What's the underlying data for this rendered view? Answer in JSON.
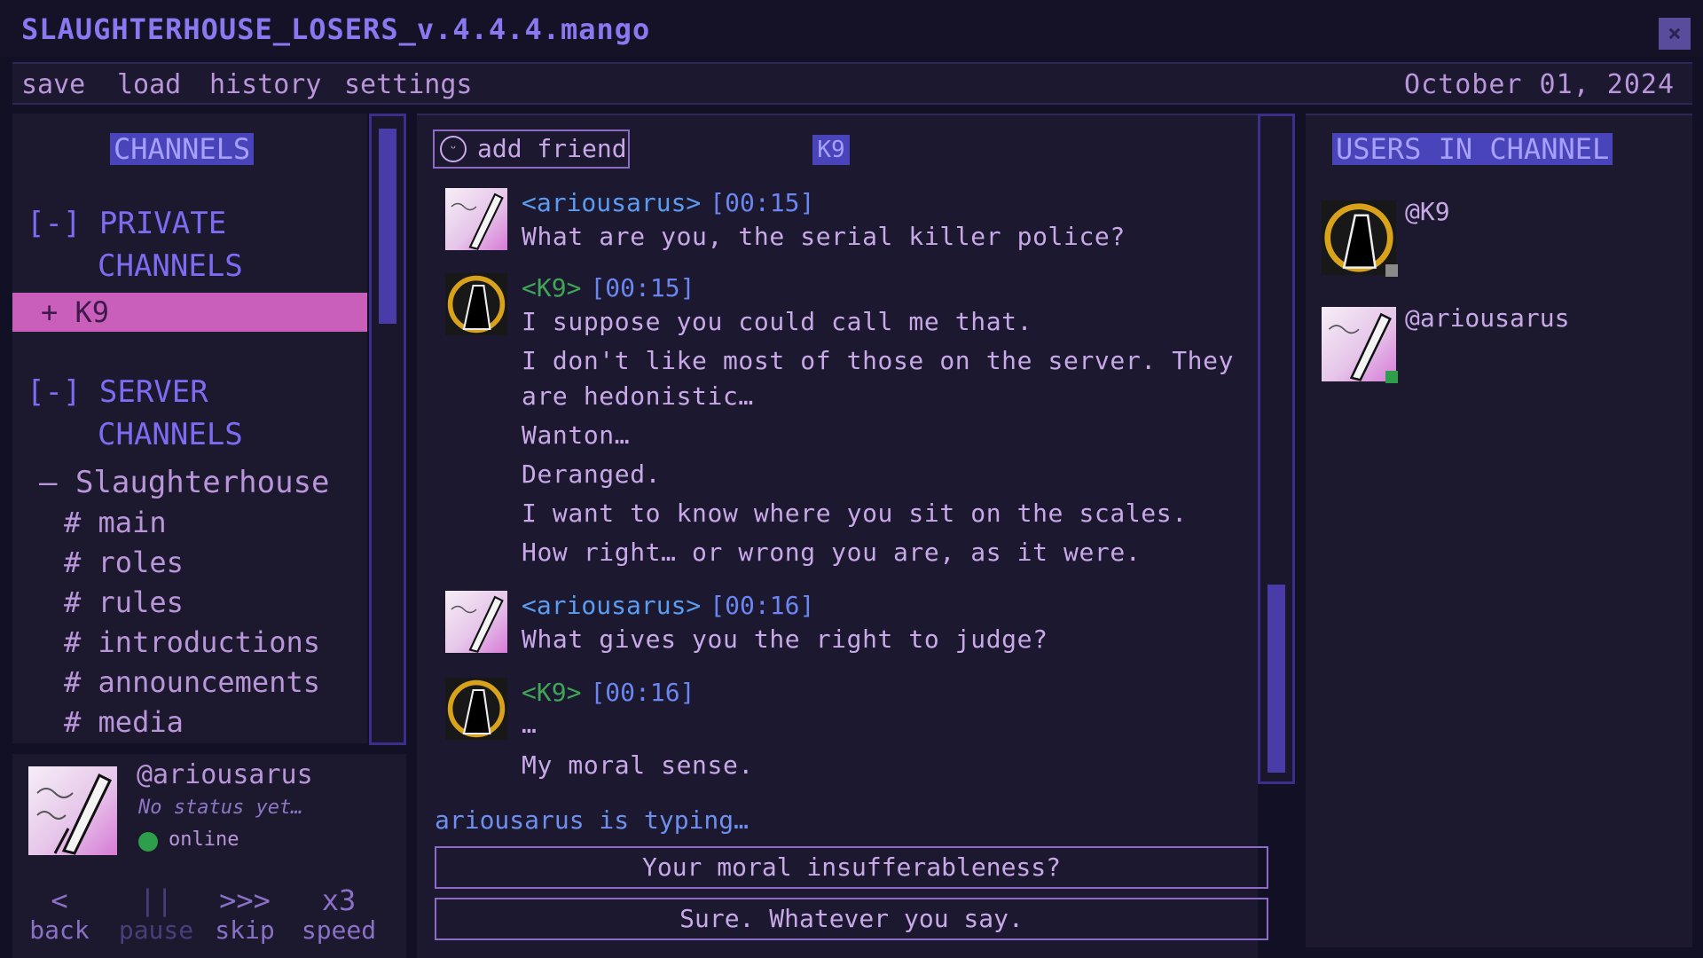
{
  "window": {
    "title": "SLAUGHTERHOUSE_LOSERS_v.4.4.4.mango",
    "close_glyph": "×"
  },
  "menu": {
    "items": [
      "save",
      "load",
      "history",
      "settings"
    ],
    "date": "October 01, 2024"
  },
  "sidebar": {
    "heading": "CHANNELS",
    "private_group": {
      "line1": "[-] PRIVATE",
      "line2": "CHANNELS"
    },
    "selected_channel": "+ K9",
    "server_group": {
      "line1": "[-] SERVER",
      "line2": "CHANNELS"
    },
    "server_name": "– Slaughterhouse",
    "channels": [
      "# main",
      "# roles",
      "# rules",
      "# introductions",
      "# announcements",
      "# media"
    ]
  },
  "current_user": {
    "name": "@ariousarus",
    "status": "No status yet…",
    "presence": "online"
  },
  "controls": [
    {
      "glyph": "<",
      "label": "back",
      "enabled": true
    },
    {
      "glyph": "||",
      "label": "pause",
      "enabled": false
    },
    {
      "glyph": ">>>",
      "label": "skip",
      "enabled": true
    },
    {
      "glyph": "x3",
      "label": "speed",
      "enabled": true
    }
  ],
  "chat": {
    "add_friend": "add friend",
    "badge": "K9",
    "messages": [
      {
        "author": "<ariousarus>",
        "time": "[00:15]",
        "lines": [
          "What are you, the serial killer police?"
        ]
      },
      {
        "author": "<K9>",
        "time": "[00:15]",
        "lines": [
          "I suppose you could call me that.",
          "I don't like most of those on the server. They",
          "are hedonistic…",
          "Wanton…",
          "Deranged.",
          "I want to know where you sit on the scales.",
          "How right… or wrong you are, as it were."
        ]
      },
      {
        "author": "<ariousarus>",
        "time": "[00:16]",
        "lines": [
          "What gives you the right to judge?"
        ]
      },
      {
        "author": "<K9>",
        "time": "[00:16]",
        "lines": [
          "…",
          "My moral sense."
        ]
      }
    ],
    "typing": "ariousarus is typing…",
    "replies": [
      "Your moral insufferableness?",
      "Sure. Whatever you say."
    ]
  },
  "users_panel": {
    "heading": "USERS IN CHANNEL",
    "users": [
      {
        "name": "@K9",
        "presence": "idle"
      },
      {
        "name": "@ariousarus",
        "presence": "online"
      }
    ]
  },
  "colors": {
    "accent": "#4a44bb",
    "selected": "#c95fba",
    "online": "#2e9e4a",
    "idle": "#8a8a8a"
  }
}
